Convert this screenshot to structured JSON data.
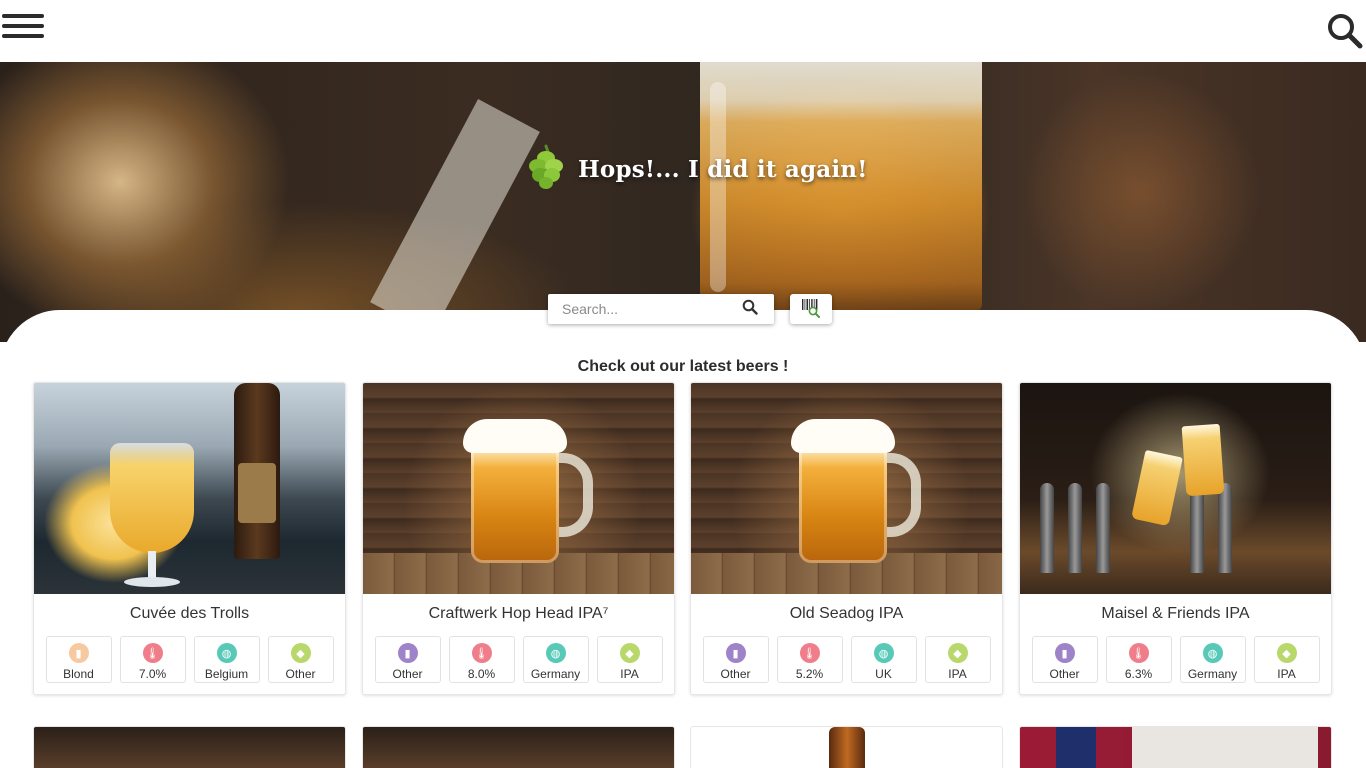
{
  "header": {
    "menu_icon": "hamburger-icon",
    "search_icon": "search-icon"
  },
  "hero": {
    "title": "Hops!... I did it again!",
    "logo_icon": "hop-cone-icon",
    "search_placeholder": "Search...",
    "barcode_icon": "barcode-scan-icon"
  },
  "section_title": "Check out our latest beers !",
  "beers": [
    {
      "name": "Cuvée des Trolls",
      "type": "Blond",
      "abv": "7.0%",
      "country": "Belgium",
      "style": "Other"
    },
    {
      "name": "Craftwerk Hop Head IPA⁷",
      "type": "Other",
      "abv": "8.0%",
      "country": "Germany",
      "style": "IPA"
    },
    {
      "name": "Old Seadog IPA",
      "type": "Other",
      "abv": "5.2%",
      "country": "UK",
      "style": "IPA"
    },
    {
      "name": "Maisel & Friends IPA",
      "type": "Other",
      "abv": "6.3%",
      "country": "Germany",
      "style": "IPA"
    }
  ],
  "colors": {
    "type_blond": "#f7c9a1",
    "type_other": "#9f83c9",
    "abv": "#ef7e8a",
    "country": "#58c9b7",
    "style": "#b9d86b"
  }
}
